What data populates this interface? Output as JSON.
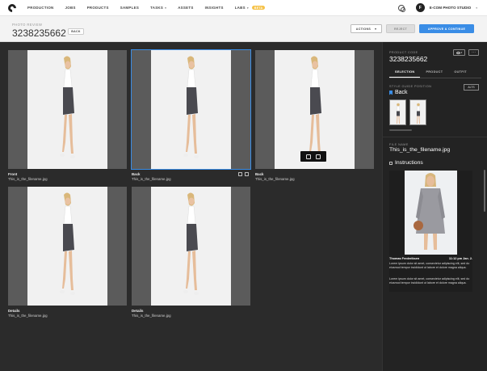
{
  "nav": {
    "items": [
      {
        "label": "PRODUCTION"
      },
      {
        "label": "JOBS"
      },
      {
        "label": "PRODUCTS"
      },
      {
        "label": "SAMPLES"
      },
      {
        "label": "TASKS"
      },
      {
        "label": "ASSETS"
      },
      {
        "label": "INSIGHTS"
      },
      {
        "label": "LABS"
      }
    ],
    "labs_badge": "BETA",
    "avatar_letter": "F",
    "studio": "E-COM PHOTO STUDIO"
  },
  "header": {
    "breadcrumb": "PHOTO REVIEW",
    "id": "3238235662",
    "back_label": "BACK",
    "actions_label": "ACTIONS",
    "reject_label": "REJECT",
    "approve_label": "APPROVE & CONTINUE"
  },
  "gallery": {
    "cards": [
      {
        "label": "Front",
        "file": "This_is_the_filename.jpg"
      },
      {
        "label": "Back",
        "file": "This_is_the_filename.jpg"
      },
      {
        "label": "Back",
        "file": "This_is_the_filename.jpg"
      },
      {
        "label": "Details",
        "file": "This_is_the_filename.jpg"
      },
      {
        "label": "Details",
        "file": "This_is_the_filename.jpg"
      }
    ]
  },
  "panel": {
    "product_code_label": "PRODUCT CODE",
    "product_code": "3238235662",
    "tabs": [
      {
        "label": "SELECTION"
      },
      {
        "label": "PRODUCT"
      },
      {
        "label": "OUTFIT"
      }
    ],
    "style_guide_label": "STYLE GUIDE POSITION",
    "alts_label": "ALTS",
    "style_guide_value": "Back",
    "file_name_label": "FILE NAME",
    "file_name": "This_is_the_filename.jpg",
    "instructions_title": "Instructions",
    "instruction": {
      "author": "Thomas Frederiksen",
      "time": "11:12 pm Jan. 2.",
      "text_1": "Lorem ipsum dolor sit amet, consectetur adipiscing elit, sed do eiusmod tempor incididunt ut labore et dolore magna aliqua.",
      "text_2": "Lorem ipsum dolor sit amet, consectetur adipiscing elit, sed do eiusmod tempor incididunt ut labore et dolore magna aliqua."
    }
  },
  "colors": {
    "accent": "#3a8de6",
    "beta": "#f6c34a"
  }
}
